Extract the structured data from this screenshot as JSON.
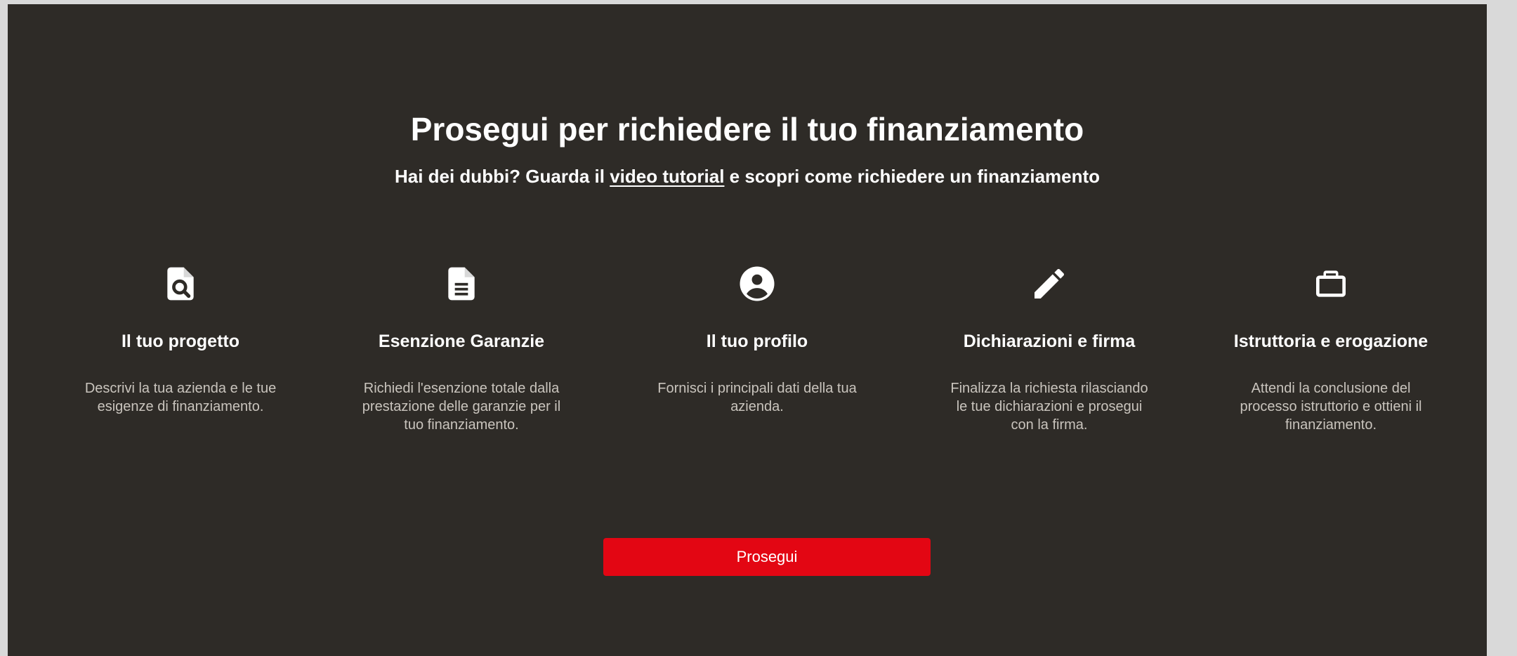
{
  "header": {
    "title": "Prosegui per richiedere il tuo finanziamento",
    "subtitle_before": "Hai dei dubbi? Guarda il ",
    "subtitle_link": "video tutorial",
    "subtitle_after": " e scopri come richiedere un finanziamento"
  },
  "steps": [
    {
      "icon": "file-search-icon",
      "title": "Il tuo progetto",
      "description": "Descrivi la tua azienda e le tue esigenze di finanziamento."
    },
    {
      "icon": "document-icon",
      "title": "Esenzione Garanzie",
      "description": "Richiedi l'esenzione totale dalla prestazione delle garanzie per il tuo finanziamento."
    },
    {
      "icon": "account-circle-icon",
      "title": "Il tuo profilo",
      "description": "Fornisci i principali dati della tua azienda."
    },
    {
      "icon": "pencil-icon",
      "title": "Dichiarazioni e firma",
      "description": "Finalizza la richiesta rilasciando le tue dichiarazioni e prosegui con la firma."
    },
    {
      "icon": "briefcase-icon",
      "title": "Istruttoria e erogazione",
      "description": "Attendi la conclusione del processo istruttorio e ottieni il finanziamento."
    }
  ],
  "cta": {
    "label": "Prosegui"
  },
  "colors": {
    "background": "#2e2b27",
    "accent": "#e30613",
    "text": "#ffffff",
    "muted_text": "#c9c4bd"
  }
}
